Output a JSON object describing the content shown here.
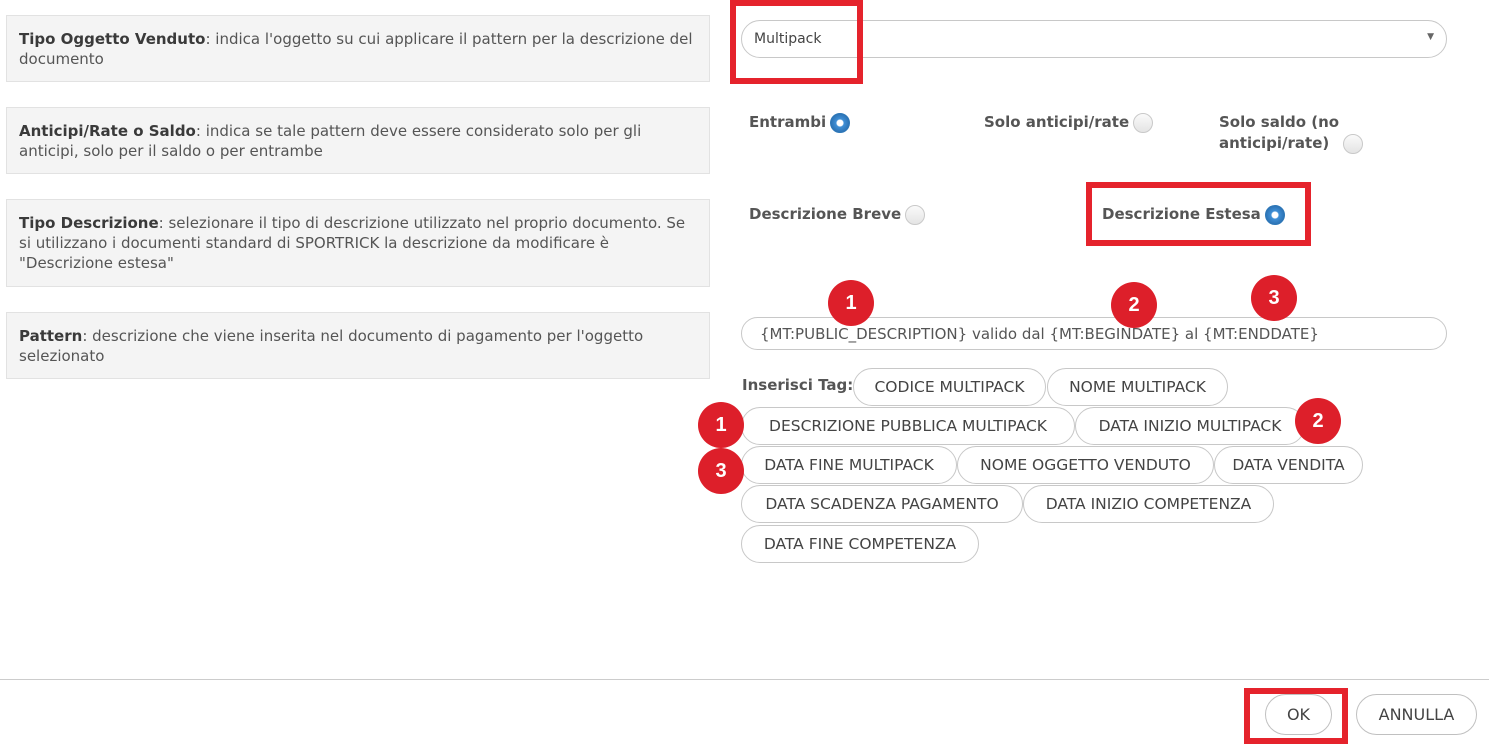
{
  "rows": [
    {
      "title": "Tipo Oggetto Venduto",
      "text": ": indica l'oggetto su cui applicare il pattern per la descrizione del documento"
    },
    {
      "title": "Anticipi/Rate o Saldo",
      "text": ": indica se tale pattern deve essere considerato solo per gli anticipi, solo per il saldo o per entrambe"
    },
    {
      "title": "Tipo Descrizione",
      "text": ": selezionare il tipo di descrizione utilizzato nel proprio documento. Se si utilizzano i documenti standard di SPORTRICK la descrizione da modificare è \"Descrizione estesa\""
    },
    {
      "title": "Pattern",
      "text": ": descrizione che viene inserita nel documento di pagamento per l'oggetto selezionato"
    }
  ],
  "object_select": {
    "value": "Multipack",
    "arrow_icon": "caret-down-icon"
  },
  "payment_options": [
    {
      "label": "Entrambi",
      "selected": true
    },
    {
      "label": "Solo anticipi/rate",
      "selected": false
    },
    {
      "label": "Solo saldo (no",
      "label2": "anticipi/rate)",
      "selected": false
    }
  ],
  "description_options": [
    {
      "label": "Descrizione Breve",
      "selected": false
    },
    {
      "label": "Descrizione Estesa",
      "selected": true
    }
  ],
  "pattern": {
    "value": "{MT:PUBLIC_DESCRIPTION} valido dal {MT:BEGINDATE} al {MT:ENDDATE}"
  },
  "tags": {
    "label": "Inserisci Tag:",
    "items": [
      "CODICE MULTIPACK",
      "NOME MULTIPACK",
      "DESCRIZIONE PUBBLICA MULTIPACK",
      "DATA INIZIO MULTIPACK",
      "DATA FINE MULTIPACK",
      "NOME OGGETTO VENDUTO",
      "DATA VENDITA",
      "DATA SCADENZA PAGAMENTO",
      "DATA INIZIO COMPETENZA",
      "DATA FINE COMPETENZA"
    ]
  },
  "annotations": {
    "badges": [
      "1",
      "2",
      "3",
      "1",
      "2",
      "3"
    ],
    "highlight_color": "#e5232c",
    "badge_color": "#dd1f2a"
  },
  "footer": {
    "ok_label": "OK",
    "cancel_label": "ANNULLA"
  },
  "colors": {
    "radio_selected": "#3f8fd6",
    "panel_bg": "#f4f4f4"
  }
}
